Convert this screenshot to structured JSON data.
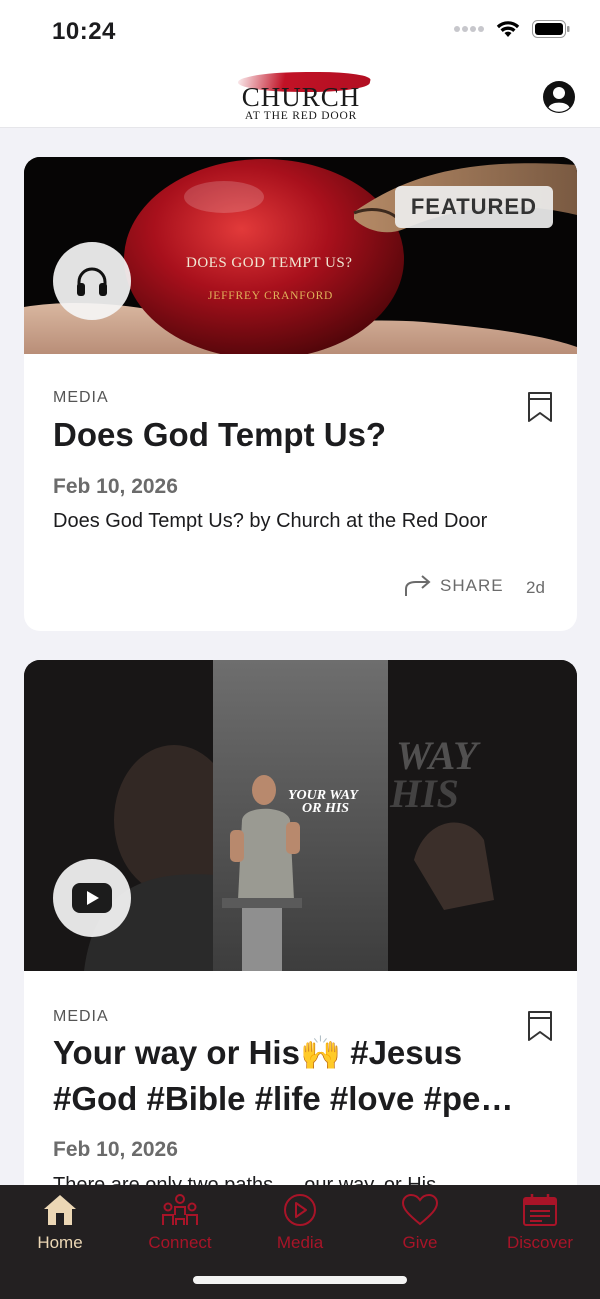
{
  "status_bar": {
    "time": "10:24"
  },
  "header": {
    "logo_name": "CHURCH",
    "logo_sub": "AT THE RED DOOR",
    "profile_icon": "person-circle-icon"
  },
  "feed": [
    {
      "badge": "FEATURED",
      "media_icon": "headphones-icon",
      "thumb_title": "DOES GOD TEMPT US?",
      "thumb_speaker": "JEFFREY CRANFORD",
      "category": "MEDIA",
      "title": "Does God Tempt Us?",
      "date": "Feb 10, 2026",
      "description": "Does God Tempt Us? by Church at the Red Door",
      "share_label": "SHARE",
      "age": "2d"
    },
    {
      "media_icon": "play-icon",
      "thumb_watermark_1": "WAY",
      "thumb_watermark_2": "HIS",
      "thumb_overlay_1": "YOUR WAY",
      "thumb_overlay_2": "OR HIS",
      "category": "MEDIA",
      "title": "Your way or His🙌 #Jesus #God #Bible #life #love #pe…",
      "date": "Feb 10, 2026",
      "description": "There are only two paths — our way, or His"
    }
  ],
  "tabs": [
    {
      "label": "Home",
      "icon": "home-icon",
      "active": true
    },
    {
      "label": "Connect",
      "icon": "people-icon",
      "active": false
    },
    {
      "label": "Media",
      "icon": "play-circle-icon",
      "active": false
    },
    {
      "label": "Give",
      "icon": "heart-icon",
      "active": false
    },
    {
      "label": "Discover",
      "icon": "calendar-icon",
      "active": false
    }
  ],
  "colors": {
    "accent_red": "#a81428",
    "tab_active": "#ecd7b5",
    "tab_bar_bg": "#232021",
    "feed_bg": "#f2f2f7"
  }
}
